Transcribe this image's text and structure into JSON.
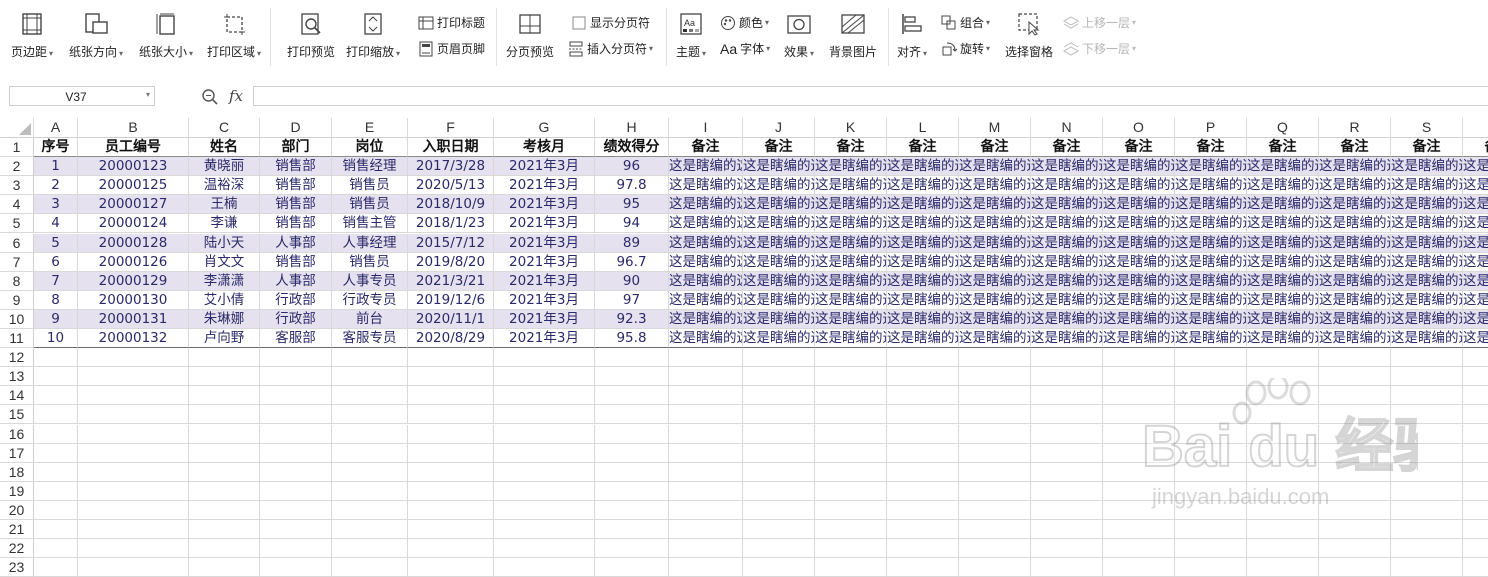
{
  "ribbon": {
    "page_margin": "页边距",
    "orientation": "纸张方向",
    "paper_size": "纸张大小",
    "print_area": "打印区域",
    "print_preview": "打印预览",
    "print_scale": "打印缩放",
    "print_titles": "打印标题",
    "header_footer": "页眉页脚",
    "page_break_preview": "分页预览",
    "show_page_breaks": "显示分页符",
    "insert_page_break": "插入分页符",
    "theme": "主题",
    "colors": "颜色",
    "fonts": "字体",
    "effects": "效果",
    "background_image": "背景图片",
    "align": "对齐",
    "group": "组合",
    "rotate": "旋转",
    "selection_pane": "选择窗格",
    "bring_forward": "上移一层",
    "send_backward": "下移一层"
  },
  "formula_bar": {
    "name_box": "V37",
    "fx": "fx",
    "value": ""
  },
  "columns": [
    "A",
    "B",
    "C",
    "D",
    "E",
    "F",
    "G",
    "H",
    "I",
    "J",
    "K",
    "L",
    "M",
    "N",
    "O",
    "P",
    "Q",
    "R",
    "S"
  ],
  "row_numbers": [
    "1",
    "2",
    "3",
    "4",
    "5",
    "6",
    "7",
    "8",
    "9",
    "10",
    "11",
    "12",
    "13",
    "14",
    "15",
    "16",
    "17",
    "18",
    "19",
    "20",
    "21",
    "22",
    "23"
  ],
  "table": {
    "headers": [
      "序号",
      "员工编号",
      "姓名",
      "部门",
      "岗位",
      "入职日期",
      "考核月",
      "绩效得分",
      "备注",
      "备注",
      "备注",
      "备注",
      "备注",
      "备注",
      "备注",
      "备注",
      "备注",
      "备注",
      "备注"
    ],
    "rows": [
      [
        "1",
        "20000123",
        "黄晓丽",
        "销售部",
        "销售经理",
        "2017/3/28",
        "2021年3月",
        "96"
      ],
      [
        "2",
        "20000125",
        "温裕深",
        "销售部",
        "销售员",
        "2020/5/13",
        "2021年3月",
        "97.8"
      ],
      [
        "3",
        "20000127",
        "王楠",
        "销售部",
        "销售员",
        "2018/10/9",
        "2021年3月",
        "95"
      ],
      [
        "4",
        "20000124",
        "李谦",
        "销售部",
        "销售主管",
        "2018/1/23",
        "2021年3月",
        "94"
      ],
      [
        "5",
        "20000128",
        "陆小天",
        "人事部",
        "人事经理",
        "2015/7/12",
        "2021年3月",
        "89"
      ],
      [
        "6",
        "20000126",
        "肖文文",
        "销售部",
        "销售员",
        "2019/8/20",
        "2021年3月",
        "96.7"
      ],
      [
        "7",
        "20000129",
        "李潇潇",
        "人事部",
        "人事专员",
        "2021/3/21",
        "2021年3月",
        "90"
      ],
      [
        "8",
        "20000130",
        "艾小倩",
        "行政部",
        "行政专员",
        "2019/12/6",
        "2021年3月",
        "97"
      ],
      [
        "9",
        "20000131",
        "朱琳娜",
        "行政部",
        "前台",
        "2020/11/1",
        "2021年3月",
        "92.3"
      ],
      [
        "10",
        "20000132",
        "卢向野",
        "客服部",
        "客服专员",
        "2020/8/29",
        "2021年3月",
        "95.8"
      ]
    ],
    "note_text": "这是瞎编的这是瞎编的"
  },
  "watermark": {
    "brand": "Bai du 经验",
    "url": "jingyan.baidu.com"
  },
  "colors": {
    "stripe": "#e6e1ef",
    "data_text": "#2a2a6a",
    "grid": "#d9d9d9"
  }
}
